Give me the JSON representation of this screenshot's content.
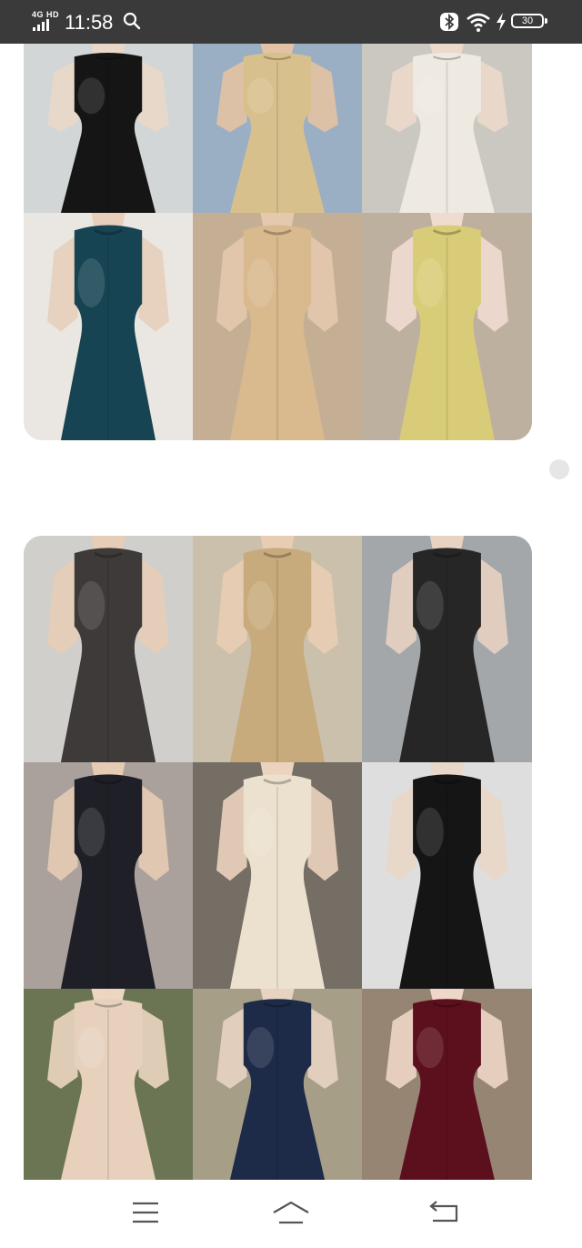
{
  "status_bar": {
    "network": "4G HD",
    "time": "11:58",
    "battery": "30",
    "icons": [
      "search-icon",
      "bluetooth-icon",
      "wifi-icon",
      "charging-icon",
      "battery-icon"
    ]
  },
  "collage_top": {
    "rows": [
      {
        "tiles": [
          {
            "name": "white-sleeve-black-qipao",
            "bg": "#cfd3d4",
            "dress": "#151515",
            "skin": "#e9d8c8"
          },
          {
            "name": "gold-short-qipao",
            "bg": "#93a9bf",
            "dress": "#d8c08c",
            "skin": "#e3c3a3"
          },
          {
            "name": "floral-sheer-sleeve-dress",
            "bg": "#c7c4bc",
            "dress": "#eeeae2",
            "skin": "#ecd9cb"
          }
        ]
      },
      {
        "tiles": [
          {
            "name": "teal-velvet-qipao",
            "bg": "#e9e5e0",
            "dress": "#174452",
            "skin": "#e7cfbc"
          },
          {
            "name": "lace-beige-qipao",
            "bg": "#bfa98c",
            "dress": "#d9b98e",
            "skin": "#e4c9ae"
          },
          {
            "name": "plaid-puff-sleeve-dress",
            "bg": "#b9aa96",
            "dress": "#d9cc78",
            "skin": "#efdcd0"
          }
        ]
      }
    ]
  },
  "collage_bottom": {
    "rows": [
      {
        "tiles": [
          {
            "name": "beaded-strapless-dress",
            "bg": "#cdcbc7",
            "dress": "#3e3a3a",
            "skin": "#e6cdb7"
          },
          {
            "name": "gold-lace-longsleeve-dress",
            "bg": "#c7bba5",
            "dress": "#c8ab7c",
            "skin": "#e8cdb3"
          },
          {
            "name": "black-floral-slip-dress",
            "bg": "#9da0a3",
            "dress": "#262626",
            "skin": "#e8d2c2"
          }
        ]
      },
      {
        "tiles": [
          {
            "name": "black-qipao-red-buttons",
            "bg": "#a39a94",
            "dress": "#1f2027",
            "skin": "#e6cbb4"
          },
          {
            "name": "cream-lace-cape-qipao",
            "bg": "#6a6258",
            "dress": "#ece1cf",
            "skin": "#ecd3bd"
          },
          {
            "name": "black-cutout-longsleeve-dress",
            "bg": "#dcdcdc",
            "dress": "#151515",
            "skin": "#e9d7c8"
          }
        ]
      },
      {
        "tiles": [
          {
            "name": "cream-dotted-qipao",
            "bg": "#5f6a45",
            "dress": "#e7d1bd",
            "skin": "#ecd6c2"
          },
          {
            "name": "navy-floral-qipao",
            "bg": "#a0967e",
            "dress": "#1d2b48",
            "skin": "#e8d3c2"
          },
          {
            "name": "burgundy-velvet-qipao",
            "bg": "#8e7b66",
            "dress": "#5c0f1c",
            "skin": "#eed6c8"
          }
        ]
      }
    ]
  },
  "nav_bar": {
    "buttons": [
      {
        "name": "menu-button",
        "icon": "menu-icon"
      },
      {
        "name": "home-button",
        "icon": "home-icon"
      },
      {
        "name": "back-button",
        "icon": "back-icon"
      }
    ]
  },
  "colors": {
    "status_bar": "#3a3a3a",
    "page_background": "#ffffff",
    "scroll_indicator": "#e6e6e6"
  }
}
